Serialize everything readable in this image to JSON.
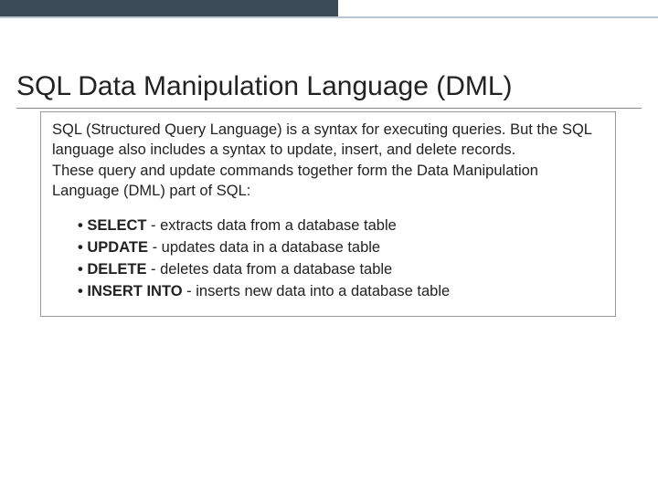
{
  "title": "SQL Data Manipulation Language (DML)",
  "desc_line1": "SQL (Structured Query Language) is a syntax for executing queries. But the SQL language also includes a syntax to update, insert, and delete records.",
  "desc_line2": "These query and update commands together form the Data Manipulation Language (DML) part of SQL:",
  "items": [
    {
      "kw": "SELECT",
      "rest": " - extracts data from a database table"
    },
    {
      "kw": "UPDATE",
      "rest": " - updates data in a database table"
    },
    {
      "kw": "DELETE",
      "rest": " - deletes data from a database table"
    },
    {
      "kw": "INSERT INTO",
      "rest": " - inserts new data into a database table"
    }
  ]
}
